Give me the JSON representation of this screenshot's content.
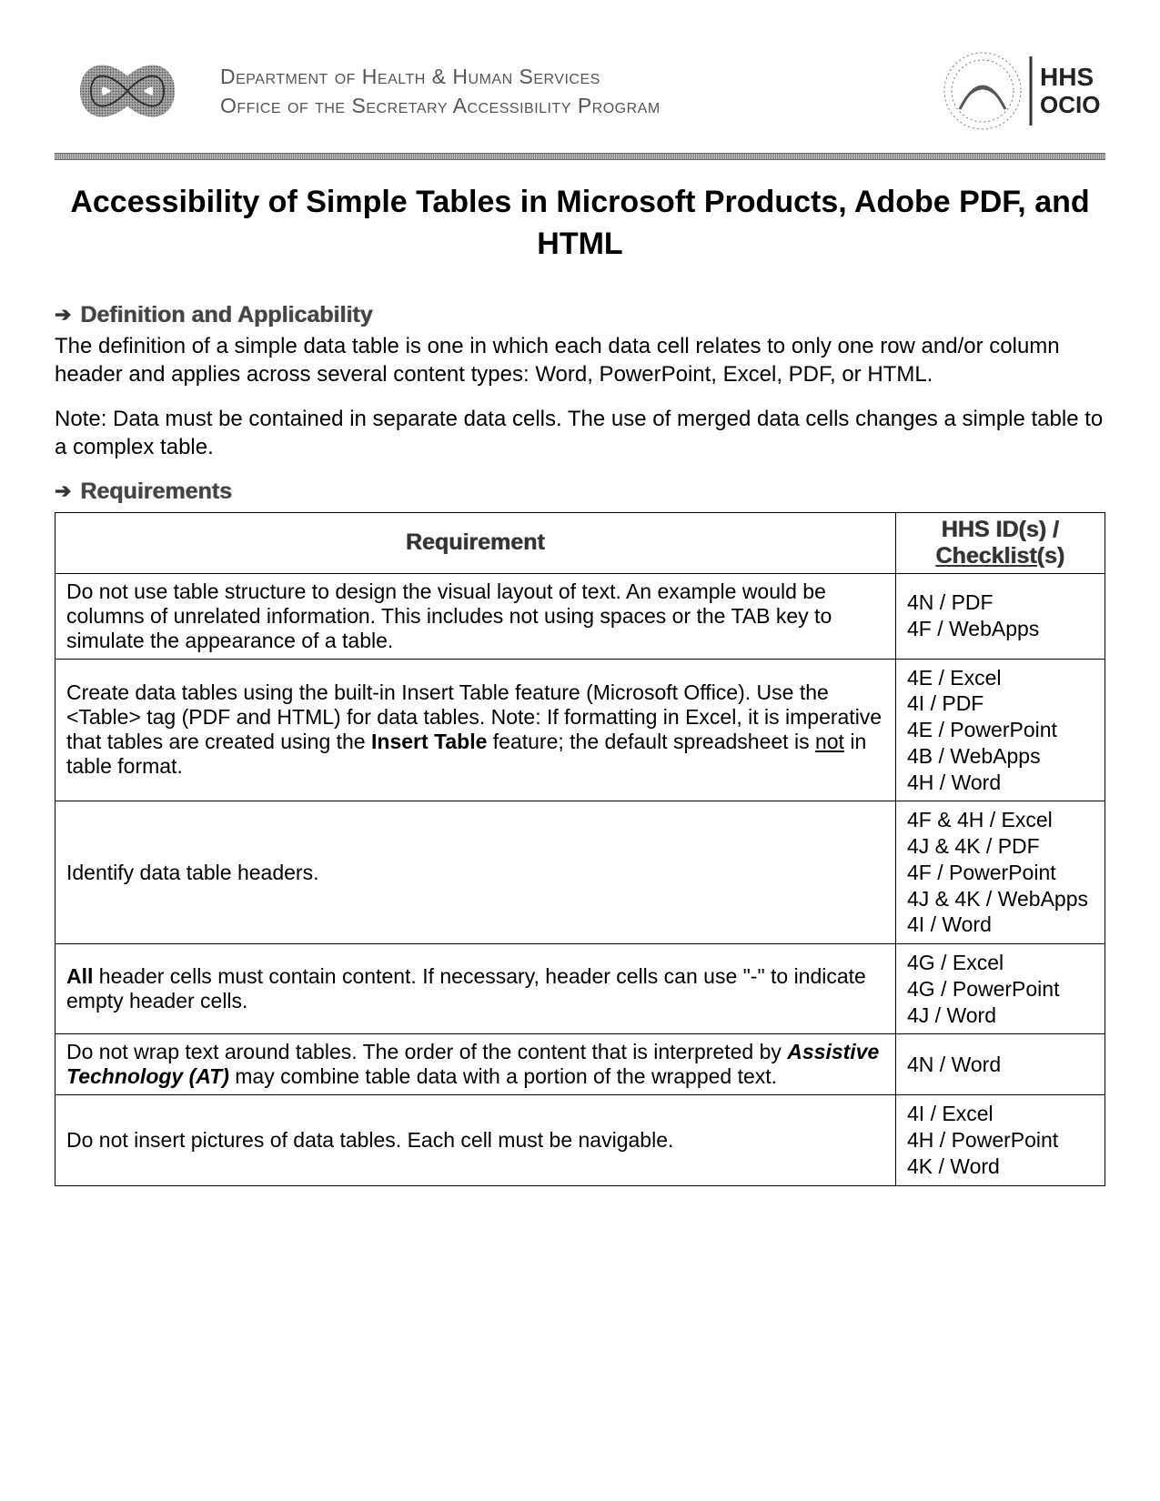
{
  "header": {
    "line1": "Department of Health & Human Services",
    "line2": "Office of the Secretary Accessibility Program",
    "logo_right_line1": "HHS",
    "logo_right_line2": "OCIO"
  },
  "title": "Accessibility of Simple Tables in Microsoft Products, Adobe PDF, and HTML",
  "sections": {
    "definition": {
      "heading": "Definition and Applicability",
      "p1": "The definition of a simple data table is one in which each data cell relates to only one row and/or column header and applies across several content types: Word, PowerPoint, Excel, PDF, or HTML.",
      "p2": "Note: Data must be contained in separate data cells. The use of merged data cells changes a simple table to a complex table."
    },
    "requirements": {
      "heading": "Requirements",
      "col1": "Requirement",
      "col2a": "HHS ID(s) /",
      "col2b": "Checklist",
      "col2c": "(s)",
      "rows": [
        {
          "req": "Do not use table structure to design the visual layout of text. An example would be columns of unrelated information. This includes not using spaces or the TAB key to simulate the appearance of a table.",
          "ids": "4N / PDF\n4F / WebApps"
        },
        {
          "req_pre": "Create data tables using the built-in Insert Table feature (Microsoft Office). Use the <Table> tag (PDF and HTML) for data tables. Note: If formatting in Excel, it is imperative that tables are created using the ",
          "req_bold": "Insert Table",
          "req_mid": " feature; the default spreadsheet is ",
          "req_u": "not",
          "req_post": " in table format.",
          "ids": "4E / Excel\n4I / PDF\n4E / PowerPoint\n4B / WebApps\n4H / Word"
        },
        {
          "req": "Identify data table headers.",
          "ids": "4F & 4H / Excel\n4J & 4K / PDF\n4F / PowerPoint\n4J & 4K / WebApps\n4I / Word"
        },
        {
          "req_bold": "All",
          "req_post": " header cells must contain content. If necessary, header cells can use \"-\" to indicate empty header cells.",
          "ids": "4G / Excel\n4G / PowerPoint\n4J / Word"
        },
        {
          "req_pre": "Do not wrap text around tables. The order of the content that is interpreted by ",
          "req_bi": "Assistive Technology (AT)",
          "req_post": " may combine table data with a portion of the wrapped text.",
          "ids": "4N / Word"
        },
        {
          "req": "Do not insert pictures of data tables. Each cell must be navigable.",
          "ids": "4I / Excel\n4H / PowerPoint\n4K / Word"
        }
      ]
    }
  }
}
